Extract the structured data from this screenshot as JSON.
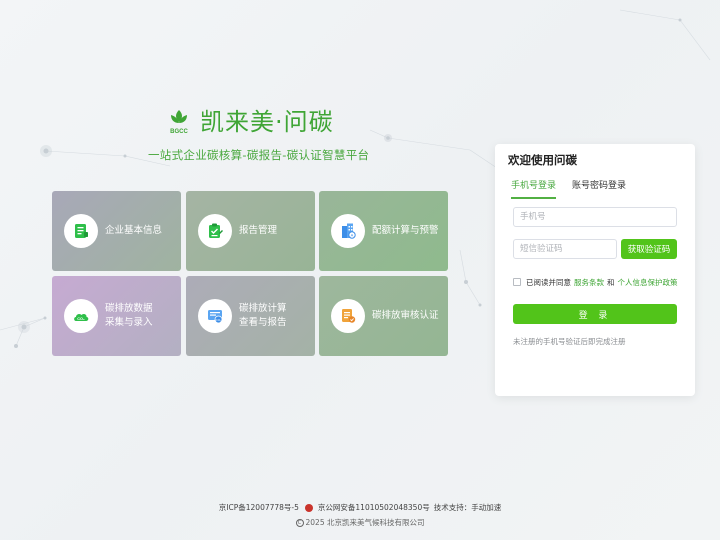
{
  "brand": {
    "logo_text": "BGCC",
    "name": "凯来美·问碳",
    "slogan": "一站式企业碳核算-碳报告-碳认证智慧平台"
  },
  "colors": {
    "brand_green": "#3fa535",
    "button_green": "#52c41a"
  },
  "tiles": [
    {
      "label1": "企业基本信息",
      "label2": "",
      "icon": "company-info-icon"
    },
    {
      "label1": "报告管理",
      "label2": "",
      "icon": "report-clipboard-icon"
    },
    {
      "label1": "配额计算与预警",
      "label2": "",
      "icon": "quota-building-icon"
    },
    {
      "label1": "碳排放数据",
      "label2": "采集与录入",
      "icon": "co2-cloud-icon"
    },
    {
      "label1": "碳排放计算",
      "label2": "查看与报告",
      "icon": "carbon-calc-icon"
    },
    {
      "label1": "碳排放审核认证",
      "label2": "",
      "icon": "audit-certificate-icon"
    }
  ],
  "login": {
    "title": "欢迎使用问碳",
    "tabs": [
      "手机号登录",
      "账号密码登录"
    ],
    "phone_placeholder": "手机号",
    "code_placeholder": "短信验证码",
    "get_code_label": "获取验证码",
    "agree_text": "已阅读并同意",
    "terms_link": "服务条款",
    "and_text": "和",
    "privacy_link": "个人信息保护政策",
    "login_label": "登 录",
    "hint": "未注册的手机号验证后即完成注册"
  },
  "footer": {
    "icp": "京ICP备12007778号-5",
    "police": "京公网安备11010502048350号",
    "tech": "技术支持：手动加速",
    "copyright": "2025 北京凯来美气候科技有限公司"
  }
}
